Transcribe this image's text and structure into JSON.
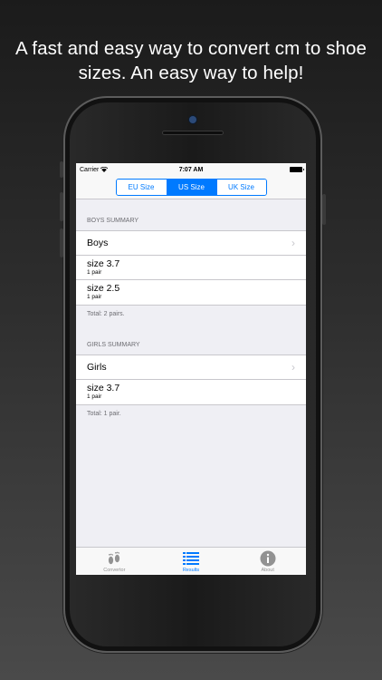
{
  "headline": {
    "line1": "A fast and easy way to convert cm to shoe",
    "line2": "sizes. An easy way to help!"
  },
  "status": {
    "carrier": "Carrier",
    "time": "7:07 AM"
  },
  "segments": [
    {
      "label": "EU Size",
      "active": false
    },
    {
      "label": "US Size",
      "active": true
    },
    {
      "label": "UK Size",
      "active": false
    }
  ],
  "boys": {
    "header": "BOYS SUMMARY",
    "nav_label": "Boys",
    "items": [
      {
        "size": "size 3.7",
        "qty": "1 pair"
      },
      {
        "size": "size 2.5",
        "qty": "1 pair"
      }
    ],
    "total": "Total: 2 pairs."
  },
  "girls": {
    "header": "GIRLS SUMMARY",
    "nav_label": "Girls",
    "items": [
      {
        "size": "size 3.7",
        "qty": "1 pair"
      }
    ],
    "total": "Total: 1 pair."
  },
  "tabs": [
    {
      "label": "Convertor",
      "icon": "footprints-icon",
      "active": false
    },
    {
      "label": "Results",
      "icon": "list-icon",
      "active": true
    },
    {
      "label": "About",
      "icon": "info-icon",
      "active": false
    }
  ],
  "colors": {
    "accent": "#007aff",
    "background": "#efeff4"
  }
}
